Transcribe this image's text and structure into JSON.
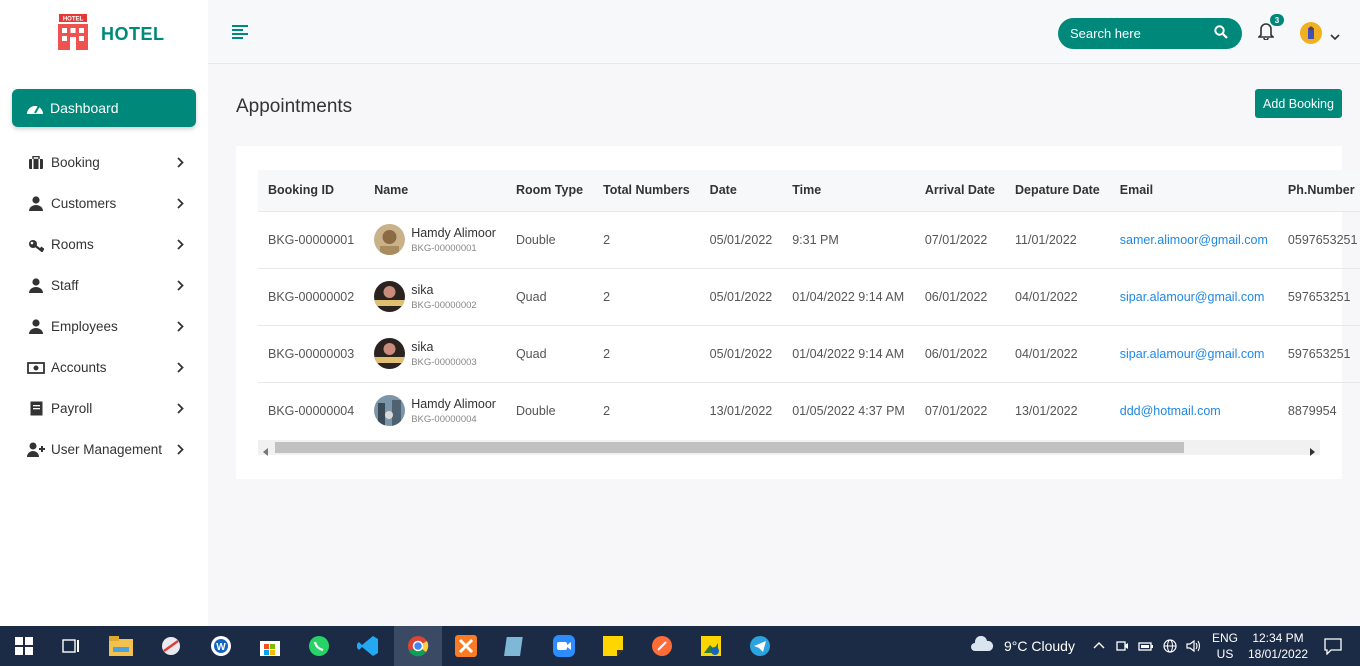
{
  "brand": {
    "name": "HOTEL"
  },
  "sidebar": {
    "dashboard": "Dashboard",
    "items": [
      {
        "label": "Booking",
        "icon": "briefcase-icon"
      },
      {
        "label": "Customers",
        "icon": "user-icon"
      },
      {
        "label": "Rooms",
        "icon": "key-icon"
      },
      {
        "label": "Staff",
        "icon": "user-icon"
      },
      {
        "label": "Employees",
        "icon": "user-icon"
      },
      {
        "label": "Accounts",
        "icon": "money-icon"
      },
      {
        "label": "Payroll",
        "icon": "file-icon"
      },
      {
        "label": "User Management",
        "icon": "user-plus-icon"
      }
    ]
  },
  "header": {
    "search_placeholder": "Search here",
    "notification_count": "3"
  },
  "page": {
    "title": "Appointments",
    "add_button": "Add Booking"
  },
  "table": {
    "columns": [
      "Booking ID",
      "Name",
      "Room Type",
      "Total Numbers",
      "Date",
      "Time",
      "Arrival Date",
      "Depature Date",
      "Email",
      "Ph.Number"
    ],
    "rows": [
      {
        "id": "BKG-00000001",
        "name": "Hamdy Alimoor",
        "sub": "BKG-00000001",
        "room": "Double",
        "total": "2",
        "date": "05/01/2022",
        "time": "9:31 PM",
        "arrival": "07/01/2022",
        "departure": "11/01/2022",
        "email": "samer.alimoor@gmail.com",
        "phone": "0597653251"
      },
      {
        "id": "BKG-00000002",
        "name": "sika",
        "sub": "BKG-00000002",
        "room": "Quad",
        "total": "2",
        "date": "05/01/2022",
        "time": "01/04/2022 9:14 AM",
        "arrival": "06/01/2022",
        "departure": "04/01/2022",
        "email": "sipar.alamour@gmail.com",
        "phone": "597653251"
      },
      {
        "id": "BKG-00000003",
        "name": "sika",
        "sub": "BKG-00000003",
        "room": "Quad",
        "total": "2",
        "date": "05/01/2022",
        "time": "01/04/2022 9:14 AM",
        "arrival": "06/01/2022",
        "departure": "04/01/2022",
        "email": "sipar.alamour@gmail.com",
        "phone": "597653251"
      },
      {
        "id": "BKG-00000004",
        "name": "Hamdy Alimoor",
        "sub": "BKG-00000004",
        "room": "Double",
        "total": "2",
        "date": "13/01/2022",
        "time": "01/05/2022 4:37 PM",
        "arrival": "07/01/2022",
        "departure": "13/01/2022",
        "email": "ddd@hotmail.com",
        "phone": "8879954"
      }
    ]
  },
  "taskbar": {
    "weather": "9°C  Cloudy",
    "lang_top": "ENG",
    "lang_bottom": "US",
    "time": "12:34 PM",
    "date": "18/01/2022"
  },
  "colors": {
    "accent": "#00897b",
    "link": "#1e88e5",
    "taskbar": "#1c2b45"
  }
}
